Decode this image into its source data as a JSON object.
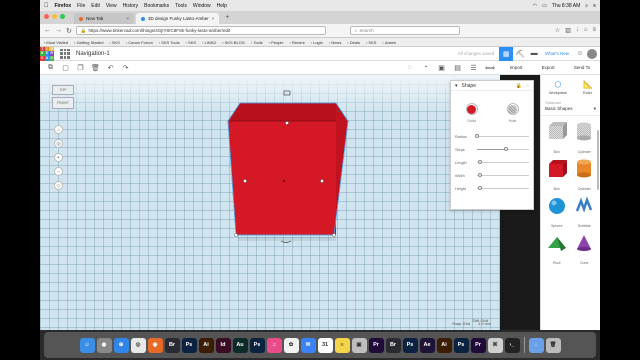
{
  "menubar": {
    "app_name": "Firefox",
    "items": [
      "File",
      "Edit",
      "View",
      "History",
      "Bookmarks",
      "Tools",
      "Window",
      "Help"
    ],
    "clock": "Thu 8:38 AM"
  },
  "browser": {
    "tabs": [
      {
        "label": "New Tab"
      },
      {
        "label": "3D design Funky Lasto-Amber"
      }
    ],
    "url": "https://www.tinkercad.com/things/4GjIY8rC8FSk-funky-lasto-amber/edit",
    "search_placeholder": "Search",
    "bookmarks": [
      "Most Visited",
      "Getting Started",
      "SKS",
      "Canon Forum",
      "SKS Tools",
      "SKS",
      "LINKD",
      "SKS BLOG",
      "Tools",
      "People",
      "Recent",
      "Login",
      "News",
      "Deals",
      "SKS",
      "Admin"
    ]
  },
  "tinkercad": {
    "logo_letters": [
      "T",
      "I",
      "N",
      "K",
      "E",
      "R",
      "C",
      "A",
      "D"
    ],
    "design_title": "Navigation-1",
    "save_status": "All changes saved",
    "whats_new": "What's New",
    "actions": [
      "Import",
      "Export",
      "Send To"
    ],
    "panel_buttons": [
      "Workplane",
      "Ruler"
    ],
    "library_section": "Tinkercad",
    "library_selected": "Basic Shapes",
    "shapes": [
      {
        "name": "Box",
        "icon": "box-hole"
      },
      {
        "name": "Cylinder",
        "icon": "cylinder-hole"
      },
      {
        "name": "Box",
        "icon": "box-red"
      },
      {
        "name": "Cylinder",
        "icon": "cylinder-orange"
      },
      {
        "name": "Sphere",
        "icon": "sphere-blue"
      },
      {
        "name": "Scribble",
        "icon": "scribble"
      },
      {
        "name": "Roof",
        "icon": "roof-green"
      },
      {
        "name": "Cone",
        "icon": "cone-purple"
      }
    ],
    "inspector": {
      "title": "Shape",
      "solid_label": "Solid",
      "hole_label": "Hole",
      "solid_color": "#d51826",
      "props": [
        {
          "name": "Radius",
          "level": 0.0
        },
        {
          "name": "Steps",
          "level": 0.55
        },
        {
          "name": "Length",
          "level": 0.05
        },
        {
          "name": "Width",
          "level": 0.05
        },
        {
          "name": "Height",
          "level": 0.05
        }
      ]
    },
    "workplane": {
      "view_labels": [
        "TOP",
        "FRONT"
      ],
      "edit_grid": "Edit Grid",
      "snap_grid": "Snap Grid",
      "snap_value": "1.0 mm",
      "cube_color": "#d51826"
    }
  },
  "dock": {
    "apps": [
      {
        "name": "Finder",
        "color": "#3a8ee6",
        "glyph": "☺"
      },
      {
        "name": "Launchpad",
        "color": "#888888",
        "glyph": "◉"
      },
      {
        "name": "Safari",
        "color": "#2f86e8",
        "glyph": "⊕"
      },
      {
        "name": "Chrome",
        "color": "#e8e8e8",
        "glyph": "◎"
      },
      {
        "name": "Firefox",
        "color": "#e66a25",
        "glyph": "◉"
      },
      {
        "name": "Br",
        "color": "#2a2a33",
        "glyph": "Br"
      },
      {
        "name": "Ps",
        "color": "#0b2340",
        "glyph": "Ps"
      },
      {
        "name": "Ai",
        "color": "#3b1e02",
        "glyph": "Ai"
      },
      {
        "name": "Id",
        "color": "#3a0c23",
        "glyph": "Id"
      },
      {
        "name": "Au",
        "color": "#0b2a2a",
        "glyph": "Au"
      },
      {
        "name": "Ps",
        "color": "#0b2340",
        "glyph": "Ps"
      },
      {
        "name": "iTunes",
        "color": "#ea4c89",
        "glyph": "♫"
      },
      {
        "name": "Photos",
        "color": "#f2f2f2",
        "glyph": "✿"
      },
      {
        "name": "Mail",
        "color": "#3b82f6",
        "glyph": "✉"
      },
      {
        "name": "Calendar",
        "color": "#ffffff",
        "glyph": "31"
      },
      {
        "name": "Notes",
        "color": "#f5d547",
        "glyph": "≡"
      },
      {
        "name": "Preview",
        "color": "#bfbfbf",
        "glyph": "▣"
      },
      {
        "name": "Pr",
        "color": "#1f0a3a",
        "glyph": "Pr"
      },
      {
        "name": "Br",
        "color": "#2a2a33",
        "glyph": "Br"
      },
      {
        "name": "Ps",
        "color": "#0b2340",
        "glyph": "Ps"
      },
      {
        "name": "Ae",
        "color": "#1e1236",
        "glyph": "Ae"
      },
      {
        "name": "Ai",
        "color": "#3b1e02",
        "glyph": "Ai"
      },
      {
        "name": "Ps",
        "color": "#0b2340",
        "glyph": "Ps"
      },
      {
        "name": "Pr",
        "color": "#1f0a3a",
        "glyph": "Pr"
      },
      {
        "name": "Finder2",
        "color": "#d0d0d0",
        "glyph": "⌘"
      },
      {
        "name": "Terminal",
        "color": "#222222",
        "glyph": "›_"
      },
      {
        "name": "Downloads",
        "color": "#6aa0e8",
        "glyph": "↓"
      },
      {
        "name": "Trash",
        "color": "#bbbbbb",
        "glyph": "🗑"
      }
    ]
  },
  "colors": {
    "accent": "#2a8ff7",
    "logo": [
      "#e13a3a",
      "#e78f24",
      "#f2c230",
      "#48b04b",
      "#2a8ff7",
      "#7a4fc4",
      "#e13a3a",
      "#2a8ff7",
      "#48b04b"
    ]
  }
}
